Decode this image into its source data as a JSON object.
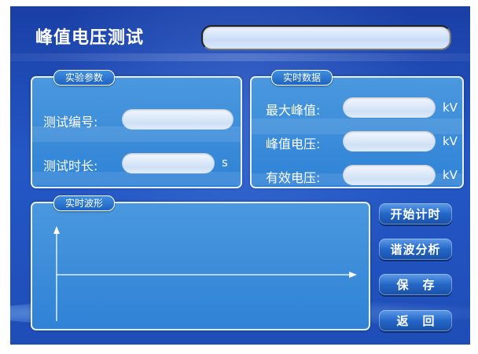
{
  "title": "峰值电压测试",
  "title_bar_value": "",
  "params_panel": {
    "tag": "实验参数",
    "test_id_label": "测试编号:",
    "test_id_value": "",
    "duration_label": "测试时长:",
    "duration_value": "",
    "duration_unit": "s"
  },
  "realtime_panel": {
    "tag": "实时数据",
    "max_peak_label": "最大峰值:",
    "max_peak_value": "",
    "max_peak_unit": "kV",
    "peak_voltage_label": "峰值电压:",
    "peak_voltage_value": "",
    "peak_voltage_unit": "kV",
    "rms_voltage_label": "有效电压:",
    "rms_voltage_value": "",
    "rms_voltage_unit": "kV"
  },
  "waveform_panel": {
    "tag": "实时波形"
  },
  "buttons": {
    "start_timer": "开始计时",
    "harmonic_analysis": "谐波分析",
    "save": "保存",
    "back": "返回"
  },
  "colors": {
    "background": "#2457c6",
    "panel": "#3a8ddc",
    "field": "#dbe8fb",
    "button": "#2467c7",
    "text": "#ffffff"
  },
  "icons": {
    "y_axis": "arrow-up",
    "x_axis": "arrow-right"
  }
}
